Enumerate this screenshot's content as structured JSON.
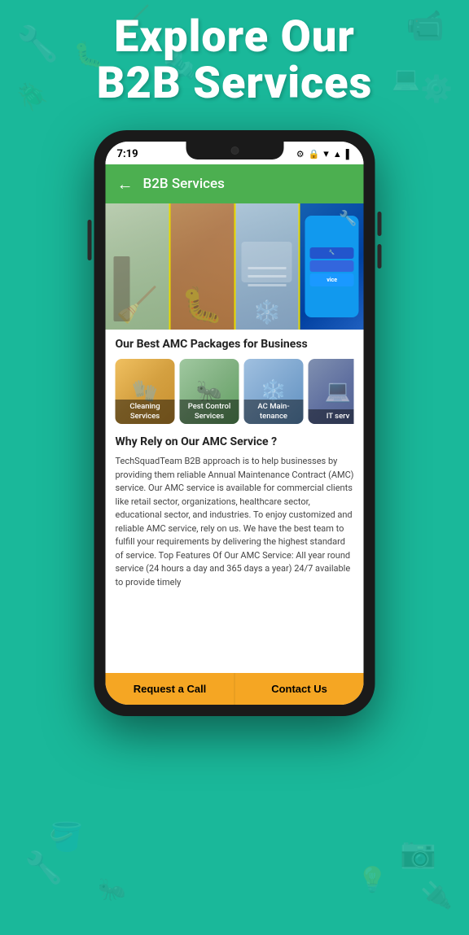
{
  "page": {
    "background_color": "#1ab89a",
    "header_title_line1": "Explore Our",
    "header_title_line2": "B2B Services"
  },
  "status_bar": {
    "time": "7:19",
    "icons": [
      "⚙",
      "🔋",
      "▲",
      "📶",
      "🔋"
    ]
  },
  "app_bar": {
    "back_arrow": "←",
    "title": "B2B Services"
  },
  "hero": {
    "images": [
      {
        "id": "hero-clean",
        "alt": "Cleaning service person with mop"
      },
      {
        "id": "hero-pest",
        "alt": "Pest control service"
      },
      {
        "id": "hero-ac",
        "alt": "AC maintenance"
      },
      {
        "id": "hero-repair",
        "alt": "Technical repair service"
      }
    ]
  },
  "amc_section": {
    "title": "Our Best AMC Packages for Business",
    "cards": [
      {
        "id": "cleaning",
        "label": "Cleaning Services"
      },
      {
        "id": "pest",
        "label": "Pest Control Services"
      },
      {
        "id": "ac",
        "label": "AC Main- tenance"
      },
      {
        "id": "it",
        "label": "IT serv"
      }
    ]
  },
  "why_section": {
    "title": "Why Rely on Our AMC Service ?",
    "description": "TechSquadTeam B2B approach is to help businesses by providing them reliable Annual Maintenance Contract (AMC) service. Our AMC service   is available for commercial clients like retail sector, organizations, healthcare sector, educational sector, and industries. To enjoy customized and   reliable AMC service, rely on us. We have the best team to fulfill your requirements by delivering the highest standard of service. Top Features Of Our AMC Service: All year round service (24 hours a day and 365 days a year) 24/7 available to provide timely"
  },
  "bottom_bar": {
    "request_label": "Request a Call",
    "contact_label": "Contact Us"
  }
}
